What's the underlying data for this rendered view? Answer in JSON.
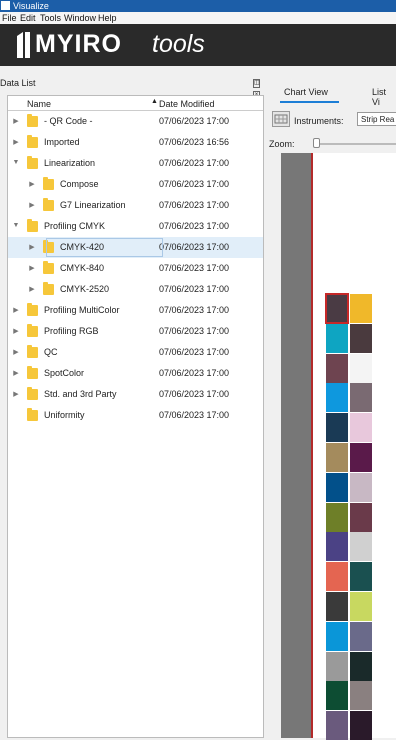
{
  "window": {
    "title": "Visualize"
  },
  "menu": [
    "File",
    "Edit",
    "Tools",
    "Window",
    "Help"
  ],
  "brand": {
    "name": "MYIRO",
    "suffix": "tools"
  },
  "data_list": {
    "title": "Data List",
    "columns": {
      "name": "Name",
      "date": "Date Modified"
    },
    "rows": [
      {
        "name": "- QR Code -",
        "date": "07/06/2023 17:00",
        "level": 0,
        "expanded": false,
        "has_children": true,
        "selected": false
      },
      {
        "name": "Imported",
        "date": "07/06/2023 16:56",
        "level": 0,
        "expanded": false,
        "has_children": true,
        "selected": false
      },
      {
        "name": "Linearization",
        "date": "07/06/2023 17:00",
        "level": 0,
        "expanded": true,
        "has_children": true,
        "selected": false
      },
      {
        "name": "Compose",
        "date": "07/06/2023 17:00",
        "level": 1,
        "expanded": false,
        "has_children": true,
        "selected": false
      },
      {
        "name": "G7 Linearization",
        "date": "07/06/2023 17:00",
        "level": 1,
        "expanded": false,
        "has_children": true,
        "selected": false
      },
      {
        "name": "Profiling CMYK",
        "date": "07/06/2023 17:00",
        "level": 0,
        "expanded": true,
        "has_children": true,
        "selected": false
      },
      {
        "name": "CMYK-420",
        "date": "07/06/2023 17:00",
        "level": 1,
        "expanded": false,
        "has_children": true,
        "selected": true
      },
      {
        "name": "CMYK-840",
        "date": "07/06/2023 17:00",
        "level": 1,
        "expanded": false,
        "has_children": true,
        "selected": false
      },
      {
        "name": "CMYK-2520",
        "date": "07/06/2023 17:00",
        "level": 1,
        "expanded": false,
        "has_children": true,
        "selected": false
      },
      {
        "name": "Profiling MultiColor",
        "date": "07/06/2023 17:00",
        "level": 0,
        "expanded": false,
        "has_children": true,
        "selected": false
      },
      {
        "name": "Profiling RGB",
        "date": "07/06/2023 17:00",
        "level": 0,
        "expanded": false,
        "has_children": true,
        "selected": false
      },
      {
        "name": "QC",
        "date": "07/06/2023 17:00",
        "level": 0,
        "expanded": false,
        "has_children": true,
        "selected": false
      },
      {
        "name": "SpotColor",
        "date": "07/06/2023 17:00",
        "level": 0,
        "expanded": false,
        "has_children": true,
        "selected": false
      },
      {
        "name": "Std. and 3rd Party",
        "date": "07/06/2023 17:00",
        "level": 0,
        "expanded": false,
        "has_children": true,
        "selected": false
      },
      {
        "name": "Uniformity",
        "date": "07/06/2023 17:00",
        "level": 0,
        "expanded": false,
        "has_children": false,
        "selected": false
      }
    ]
  },
  "chart_panel": {
    "tabs": [
      "Chart View",
      "List Vi"
    ],
    "active_tab": "Chart View",
    "instruments_label": "Instruments:",
    "instrument_value": "Strip Rea",
    "zoom_label": "Zoom:",
    "patch_columns": [
      [
        "#4a3b44",
        "#0ea5c2",
        "#6e4450",
        "#0e98de",
        "#1a3a55",
        "#a48b5d",
        "#02508a",
        "#6e7f28",
        "#4b4285",
        "#e46551",
        "#3a3a3a",
        "#0a96d8",
        "#9a9a9a",
        "#0d4d33",
        "#6a5a7d"
      ],
      [
        "#f0b82a",
        "#4a3a3e",
        "#f4f4f4",
        "#7a6a72",
        "#e8c8dc",
        "#5a1a4a",
        "#c8b8c4",
        "#6a3a4a",
        "#d0d0d0",
        "#1a5050",
        "#c8d860",
        "#6a6a8a",
        "#1a2a2a",
        "#8a8080",
        "#2a1a2a"
      ]
    ],
    "selected_patch": [
      0,
      0
    ]
  },
  "colors": {
    "title_bar": "#1c5ea8",
    "brand_bar": "#2a2a2a",
    "folder": "#f6c73a",
    "selection": "#e1eef9",
    "accent": "#1c7ed6"
  }
}
